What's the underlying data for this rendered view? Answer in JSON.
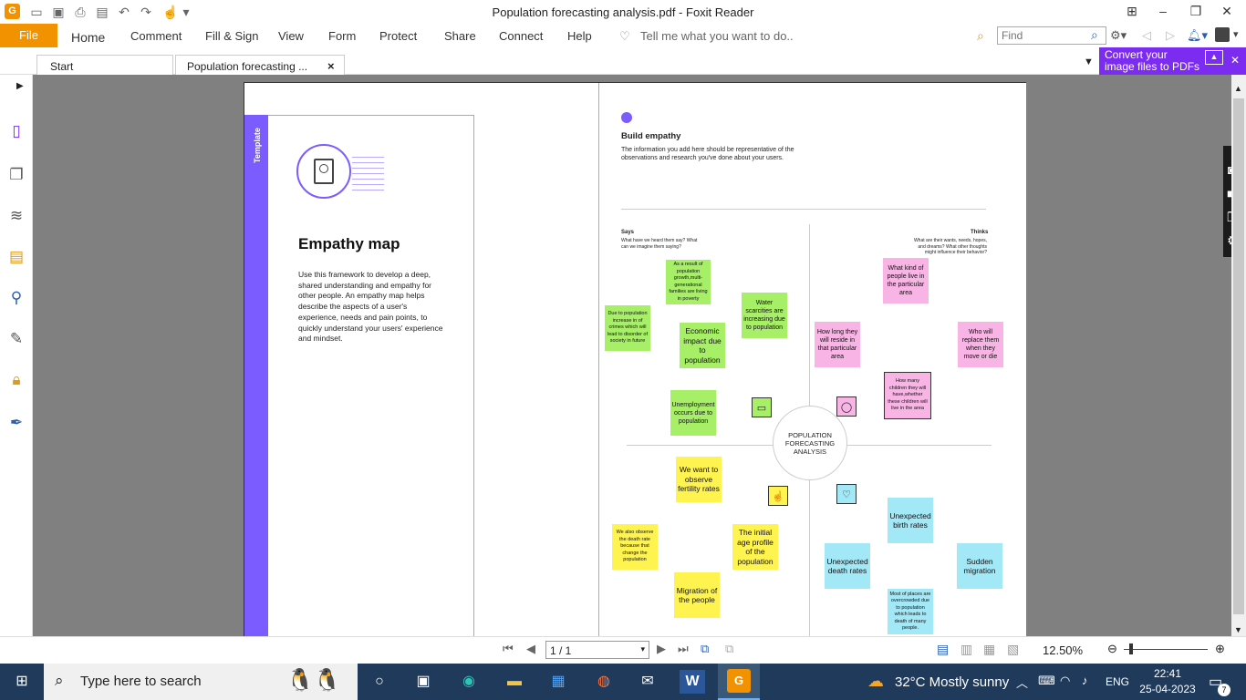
{
  "window": {
    "title": "Population forecasting analysis.pdf - Foxit Reader"
  },
  "ribbon": {
    "file": "File",
    "menus": [
      "Home",
      "Comment",
      "Fill & Sign",
      "View",
      "Form",
      "Protect",
      "Share",
      "Connect",
      "Help"
    ],
    "tell_me": "Tell me what you want to do..",
    "find_placeholder": "Find"
  },
  "tabs": {
    "start": "Start",
    "doc": "Population forecasting ...",
    "close": "×"
  },
  "promo": {
    "line1": "Convert your",
    "line2": "image files to PDFs"
  },
  "doc": {
    "template_label": "Template",
    "empathy_title": "Empathy map",
    "empathy_desc": "Use this framework to develop a deep, shared understanding and empathy for other people. An empathy map helps describe the aspects of a user's experience, needs and pain points, to quickly understand your users' experience and mindset.",
    "build_title": "Build empathy",
    "build_desc": "The information you add here should be representative of the observations and research you've done about your users.",
    "says_title": "Says",
    "says_desc": "What have we heard them say? What can we imagine them saying?",
    "thinks_title": "Thinks",
    "thinks_desc": "What are their wants, needs, hopes, and dreams? What other thoughts might influence their behavior?",
    "center": "POPULATION FORECASTING ANALYSIS",
    "notes": {
      "g1": "As a result of population growth,multi-generational families are living in poverty",
      "g2": "Water scarcities are increasing due to population",
      "g3": "Due to population increase in of crimes which will lead to disorder of society in future",
      "g4": "Economic impact due to population",
      "g5": "Unemployment occurs due to population",
      "p1": "What kind of people live in the particular area",
      "p2": "How long they will reside in that particular area",
      "p3": "Who will replace them when they move or die",
      "p4": "How many children they will have,whether these children will live in the area",
      "y1": "We want to observe fertility rates",
      "y2": "We also observe the death rate because that change the population",
      "y3": "The initial age profile of the population",
      "y4": "Migration of the people",
      "b1": "Unexpected birth rates",
      "b2": "Unexpected death rates",
      "b3": "Sudden migration",
      "b4": "Most of places are overcrowded due to population which leads to death of many people."
    }
  },
  "status": {
    "page": "1 / 1",
    "zoom": "12.50%"
  },
  "taskbar": {
    "search": "Type here to search",
    "weather": "32°C  Mostly sunny",
    "lang": "ENG",
    "time": "22:41",
    "date": "25-04-2023",
    "notif": "7"
  }
}
